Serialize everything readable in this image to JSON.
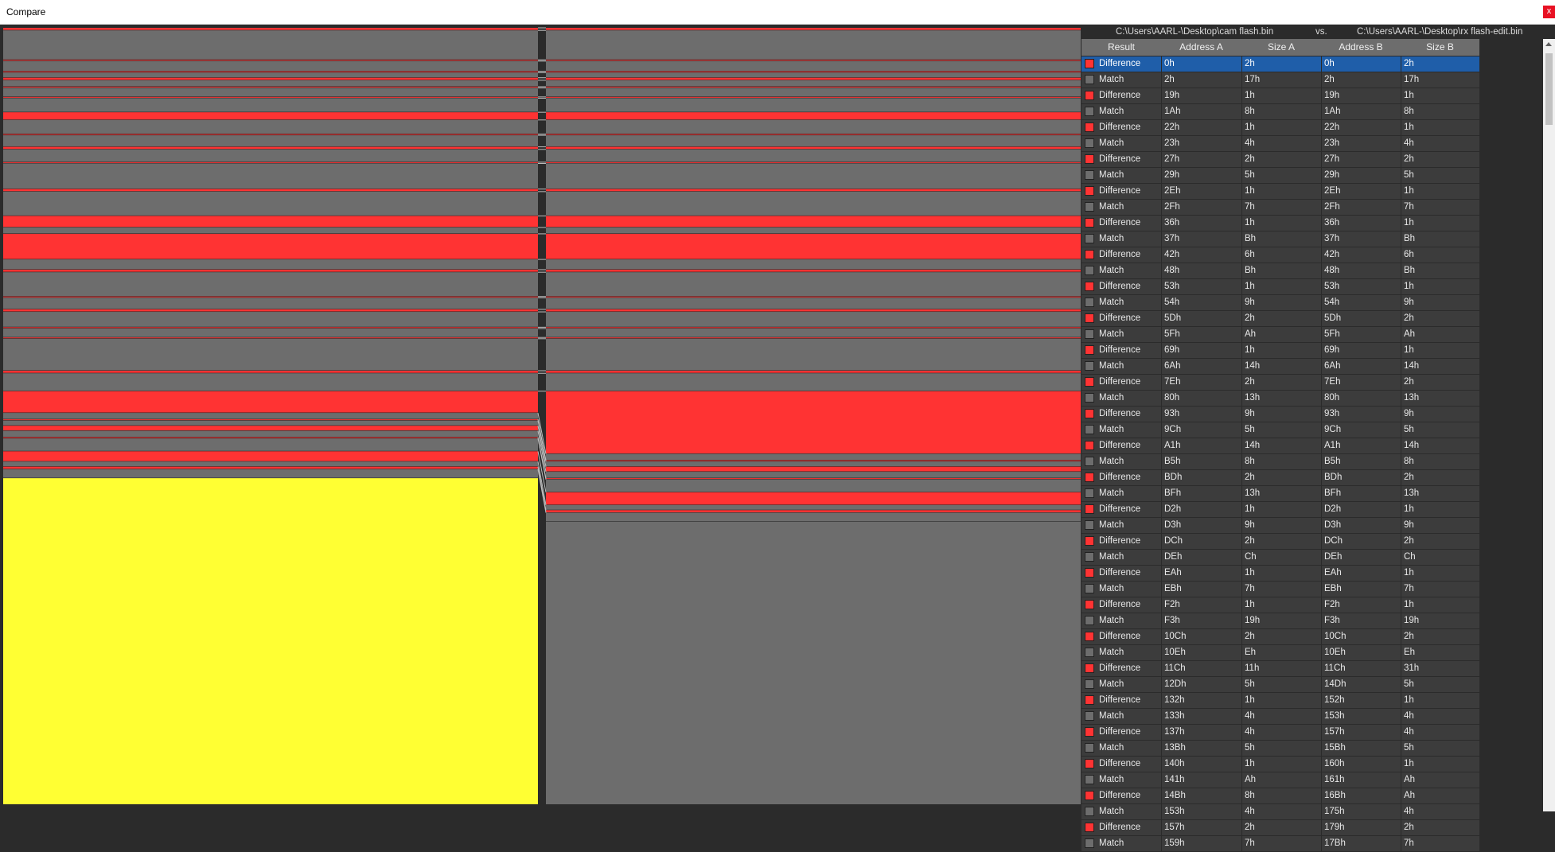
{
  "window": {
    "title": "Compare",
    "close_label": "x"
  },
  "files": {
    "a": "C:\\Users\\AARL-\\Desktop\\cam flash.bin",
    "vs": "vs.",
    "b": "C:\\Users\\AARL-\\Desktop\\rx flash-edit.bin"
  },
  "columns": [
    "Result",
    "Address A",
    "Size A",
    "Address B",
    "Size B"
  ],
  "colors": {
    "difference": "#ff3333",
    "match": "#6d6d6d",
    "inserted": "#ffff33",
    "selected": "#1f5ea9"
  },
  "rows": [
    {
      "result": "Difference",
      "address_a": "0h",
      "size_a": "2h",
      "address_b": "0h",
      "size_b": "2h"
    },
    {
      "result": "Match",
      "address_a": "2h",
      "size_a": "17h",
      "address_b": "2h",
      "size_b": "17h"
    },
    {
      "result": "Difference",
      "address_a": "19h",
      "size_a": "1h",
      "address_b": "19h",
      "size_b": "1h"
    },
    {
      "result": "Match",
      "address_a": "1Ah",
      "size_a": "8h",
      "address_b": "1Ah",
      "size_b": "8h"
    },
    {
      "result": "Difference",
      "address_a": "22h",
      "size_a": "1h",
      "address_b": "22h",
      "size_b": "1h"
    },
    {
      "result": "Match",
      "address_a": "23h",
      "size_a": "4h",
      "address_b": "23h",
      "size_b": "4h"
    },
    {
      "result": "Difference",
      "address_a": "27h",
      "size_a": "2h",
      "address_b": "27h",
      "size_b": "2h"
    },
    {
      "result": "Match",
      "address_a": "29h",
      "size_a": "5h",
      "address_b": "29h",
      "size_b": "5h"
    },
    {
      "result": "Difference",
      "address_a": "2Eh",
      "size_a": "1h",
      "address_b": "2Eh",
      "size_b": "1h"
    },
    {
      "result": "Match",
      "address_a": "2Fh",
      "size_a": "7h",
      "address_b": "2Fh",
      "size_b": "7h"
    },
    {
      "result": "Difference",
      "address_a": "36h",
      "size_a": "1h",
      "address_b": "36h",
      "size_b": "1h"
    },
    {
      "result": "Match",
      "address_a": "37h",
      "size_a": "Bh",
      "address_b": "37h",
      "size_b": "Bh"
    },
    {
      "result": "Difference",
      "address_a": "42h",
      "size_a": "6h",
      "address_b": "42h",
      "size_b": "6h"
    },
    {
      "result": "Match",
      "address_a": "48h",
      "size_a": "Bh",
      "address_b": "48h",
      "size_b": "Bh"
    },
    {
      "result": "Difference",
      "address_a": "53h",
      "size_a": "1h",
      "address_b": "53h",
      "size_b": "1h"
    },
    {
      "result": "Match",
      "address_a": "54h",
      "size_a": "9h",
      "address_b": "54h",
      "size_b": "9h"
    },
    {
      "result": "Difference",
      "address_a": "5Dh",
      "size_a": "2h",
      "address_b": "5Dh",
      "size_b": "2h"
    },
    {
      "result": "Match",
      "address_a": "5Fh",
      "size_a": "Ah",
      "address_b": "5Fh",
      "size_b": "Ah"
    },
    {
      "result": "Difference",
      "address_a": "69h",
      "size_a": "1h",
      "address_b": "69h",
      "size_b": "1h"
    },
    {
      "result": "Match",
      "address_a": "6Ah",
      "size_a": "14h",
      "address_b": "6Ah",
      "size_b": "14h"
    },
    {
      "result": "Difference",
      "address_a": "7Eh",
      "size_a": "2h",
      "address_b": "7Eh",
      "size_b": "2h"
    },
    {
      "result": "Match",
      "address_a": "80h",
      "size_a": "13h",
      "address_b": "80h",
      "size_b": "13h"
    },
    {
      "result": "Difference",
      "address_a": "93h",
      "size_a": "9h",
      "address_b": "93h",
      "size_b": "9h"
    },
    {
      "result": "Match",
      "address_a": "9Ch",
      "size_a": "5h",
      "address_b": "9Ch",
      "size_b": "5h"
    },
    {
      "result": "Difference",
      "address_a": "A1h",
      "size_a": "14h",
      "address_b": "A1h",
      "size_b": "14h"
    },
    {
      "result": "Match",
      "address_a": "B5h",
      "size_a": "8h",
      "address_b": "B5h",
      "size_b": "8h"
    },
    {
      "result": "Difference",
      "address_a": "BDh",
      "size_a": "2h",
      "address_b": "BDh",
      "size_b": "2h"
    },
    {
      "result": "Match",
      "address_a": "BFh",
      "size_a": "13h",
      "address_b": "BFh",
      "size_b": "13h"
    },
    {
      "result": "Difference",
      "address_a": "D2h",
      "size_a": "1h",
      "address_b": "D2h",
      "size_b": "1h"
    },
    {
      "result": "Match",
      "address_a": "D3h",
      "size_a": "9h",
      "address_b": "D3h",
      "size_b": "9h"
    },
    {
      "result": "Difference",
      "address_a": "DCh",
      "size_a": "2h",
      "address_b": "DCh",
      "size_b": "2h"
    },
    {
      "result": "Match",
      "address_a": "DEh",
      "size_a": "Ch",
      "address_b": "DEh",
      "size_b": "Ch"
    },
    {
      "result": "Difference",
      "address_a": "EAh",
      "size_a": "1h",
      "address_b": "EAh",
      "size_b": "1h"
    },
    {
      "result": "Match",
      "address_a": "EBh",
      "size_a": "7h",
      "address_b": "EBh",
      "size_b": "7h"
    },
    {
      "result": "Difference",
      "address_a": "F2h",
      "size_a": "1h",
      "address_b": "F2h",
      "size_b": "1h"
    },
    {
      "result": "Match",
      "address_a": "F3h",
      "size_a": "19h",
      "address_b": "F3h",
      "size_b": "19h"
    },
    {
      "result": "Difference",
      "address_a": "10Ch",
      "size_a": "2h",
      "address_b": "10Ch",
      "size_b": "2h"
    },
    {
      "result": "Match",
      "address_a": "10Eh",
      "size_a": "Eh",
      "address_b": "10Eh",
      "size_b": "Eh"
    },
    {
      "result": "Difference",
      "address_a": "11Ch",
      "size_a": "11h",
      "address_b": "11Ch",
      "size_b": "31h"
    },
    {
      "result": "Match",
      "address_a": "12Dh",
      "size_a": "5h",
      "address_b": "14Dh",
      "size_b": "5h"
    },
    {
      "result": "Difference",
      "address_a": "132h",
      "size_a": "1h",
      "address_b": "152h",
      "size_b": "1h"
    },
    {
      "result": "Match",
      "address_a": "133h",
      "size_a": "4h",
      "address_b": "153h",
      "size_b": "4h"
    },
    {
      "result": "Difference",
      "address_a": "137h",
      "size_a": "4h",
      "address_b": "157h",
      "size_b": "4h"
    },
    {
      "result": "Match",
      "address_a": "13Bh",
      "size_a": "5h",
      "address_b": "15Bh",
      "size_b": "5h"
    },
    {
      "result": "Difference",
      "address_a": "140h",
      "size_a": "1h",
      "address_b": "160h",
      "size_b": "1h"
    },
    {
      "result": "Match",
      "address_a": "141h",
      "size_a": "Ah",
      "address_b": "161h",
      "size_b": "Ah"
    },
    {
      "result": "Difference",
      "address_a": "14Bh",
      "size_a": "8h",
      "address_b": "16Bh",
      "size_b": "Ah"
    },
    {
      "result": "Match",
      "address_a": "153h",
      "size_a": "4h",
      "address_b": "175h",
      "size_b": "4h"
    },
    {
      "result": "Difference",
      "address_a": "157h",
      "size_a": "2h",
      "address_b": "179h",
      "size_b": "2h"
    },
    {
      "result": "Match",
      "address_a": "159h",
      "size_a": "7h",
      "address_b": "17Bh",
      "size_b": "7h"
    }
  ]
}
